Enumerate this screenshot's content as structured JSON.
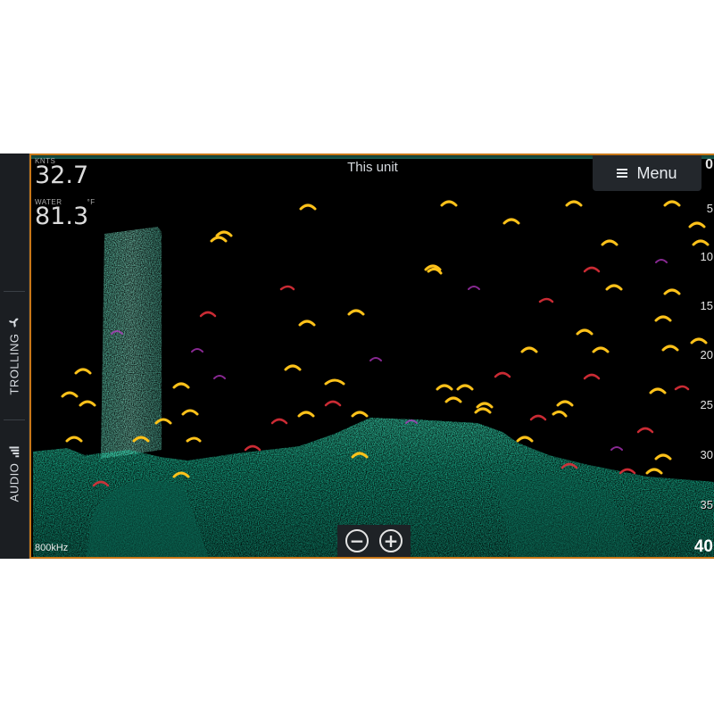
{
  "sidebar": {
    "trolling_label": "TROLLING",
    "audio_label": "AUDIO"
  },
  "screen": {
    "title": "This unit",
    "menu_label": "Menu",
    "frequency": "800kHz",
    "speed": {
      "label_left": "KNTS",
      "label_right": "",
      "value": "32.7"
    },
    "water_temp": {
      "label_left": "WATER",
      "label_right": "°F",
      "value": "81.3"
    },
    "depth_scale": [
      "0",
      "5",
      "10",
      "15",
      "20",
      "25",
      "30",
      "35"
    ],
    "depth_bottom": "40",
    "zoom_out": "−",
    "zoom_in": "+"
  },
  "colors": {
    "frame_accent": "#c77718",
    "bottom_return": "#1fd1a6",
    "fish_arch": "#ffcc1a",
    "background": "#000000"
  },
  "icons": {
    "trolling": "propeller-icon",
    "audio": "bars-icon",
    "menu": "hamburger-icon"
  }
}
